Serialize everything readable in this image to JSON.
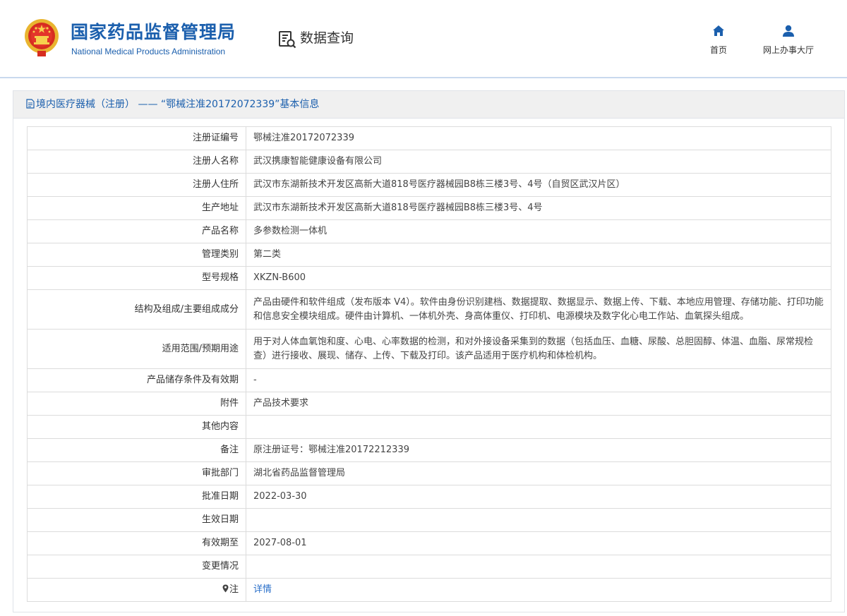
{
  "header": {
    "brand_cn": "国家药品监督管理局",
    "brand_en": "National Medical Products Administration",
    "query_title": "数据查询",
    "nav": [
      {
        "label": "首页",
        "icon": "home-icon"
      },
      {
        "label": "网上办事大厅",
        "icon": "user-icon"
      }
    ]
  },
  "panel": {
    "title": "境内医疗器械（注册） —— “鄂械注准20172072339”基本信息"
  },
  "rows": [
    {
      "label": "注册证编号",
      "value": "鄂械注准20172072339"
    },
    {
      "label": "注册人名称",
      "value": "武汉携康智能健康设备有限公司"
    },
    {
      "label": "注册人住所",
      "value": "武汉市东湖新技术开发区高新大道818号医疗器械园B8栋三楼3号、4号（自贸区武汉片区）"
    },
    {
      "label": "生产地址",
      "value": "武汉市东湖新技术开发区高新大道818号医疗器械园B8栋三楼3号、4号"
    },
    {
      "label": "产品名称",
      "value": "多参数检测一体机"
    },
    {
      "label": "管理类别",
      "value": "第二类"
    },
    {
      "label": "型号规格",
      "value": "XKZN-B600"
    },
    {
      "label": "结构及组成/主要组成成分",
      "value": "产品由硬件和软件组成（发布版本 V4）。软件由身份识别建档、数据提取、数据显示、数据上传、下载、本地应用管理、存储功能、打印功能和信息安全模块组成。硬件由计算机、一体机外壳、身高体重仪、打印机、电源模块及数字化心电工作站、血氧探头组成。"
    },
    {
      "label": "适用范围/预期用途",
      "value": "用于对人体血氧饱和度、心电、心率数据的检测，和对外接设备采集到的数据（包括血压、血糖、尿酸、总胆固醇、体温、血脂、尿常规检查）进行接收、展现、储存、上传、下载及打印。该产品适用于医疗机构和体检机构。"
    },
    {
      "label": "产品储存条件及有效期",
      "value": "-"
    },
    {
      "label": "附件",
      "value": "产品技术要求"
    },
    {
      "label": "其他内容",
      "value": ""
    },
    {
      "label": "备注",
      "value": "原注册证号：鄂械注准20172212339"
    },
    {
      "label": "审批部门",
      "value": "湖北省药品监督管理局"
    },
    {
      "label": "批准日期",
      "value": "2022-03-30"
    },
    {
      "label": "生效日期",
      "value": ""
    },
    {
      "label": "有效期至",
      "value": "2027-08-01"
    },
    {
      "label": "变更情况",
      "value": ""
    },
    {
      "label": "注",
      "value": "详情"
    }
  ],
  "colors": {
    "brand": "#1b5fad",
    "link": "#2a6fc9",
    "title_bg": "#f0f0f0"
  }
}
